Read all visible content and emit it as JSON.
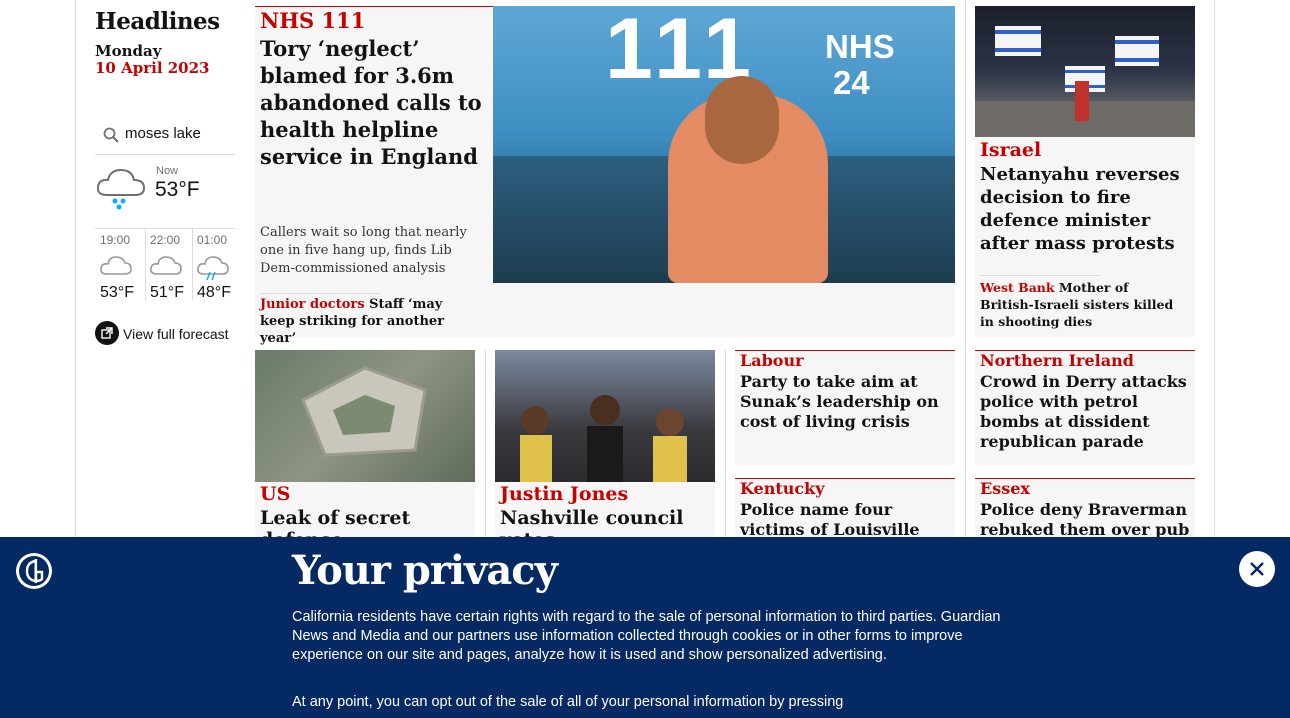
{
  "left": {
    "section_title": "Headlines",
    "day": "Monday",
    "date": "10 April 2023",
    "location_value": "moses lake",
    "weather_now_label": "Now",
    "weather_now_temp": "53°F",
    "forecast": [
      {
        "time": "19:00",
        "temp": "53°F",
        "icon": "cloud-icon"
      },
      {
        "time": "22:00",
        "temp": "51°F",
        "icon": "cloud-icon"
      },
      {
        "time": "01:00",
        "temp": "48°F",
        "icon": "cloud-rain-icon"
      }
    ],
    "full_forecast_label": "View full forecast"
  },
  "stories": {
    "main": {
      "kicker": "NHS 111",
      "headline": "Tory ‘neglect’ blamed for 3.6m abandoned calls to health helpline service in England",
      "standfirst": "Callers wait so long that nearly one in five hang up, finds Lib Dem-commissioned analysis",
      "sub_kicker": "Junior doctors",
      "sub_text": "Staff ‘may keep striking for another year’",
      "image_text_1": "111",
      "image_text_2": "NHS",
      "image_text_3": "24"
    },
    "israel": {
      "kicker": "Israel",
      "headline": "Netanyahu reverses decision to fire defence minister after mass protests",
      "sub_kicker": "West Bank",
      "sub_text": "Mother of British-Israeli sisters killed in shooting dies"
    },
    "us": {
      "kicker": "US",
      "headline": "Leak of secret defence"
    },
    "justin": {
      "kicker": "Justin Jones",
      "headline": "Nashville council votes"
    },
    "labour": {
      "kicker": "Labour",
      "headline": "Party to take aim at Sunak’s leadership on cost of living crisis"
    },
    "ni": {
      "kicker": "Northern Ireland",
      "headline": "Crowd in Derry attacks police with petrol bombs at dissident republican parade"
    },
    "kentucky": {
      "kicker": "Kentucky",
      "headline": "Police name four victims of Louisville bank shooting"
    },
    "essex": {
      "kicker": "Essex",
      "headline": "Police deny Braverman rebuked them over pub"
    }
  },
  "privacy": {
    "title": "Your privacy",
    "para1": "California residents have certain rights with regard to the sale of personal information to third parties. Guardian News and Media and our partners use information collected through cookies or in other forms to improve experience on our site and pages, analyze how it is used and show personalized advertising.",
    "para2": "At any point, you can opt out of the sale of all of your personal information by pressing"
  },
  "colors": {
    "brand_red": "#c70000",
    "banner_blue": "#052962",
    "card_bg": "#f6f6f6"
  }
}
